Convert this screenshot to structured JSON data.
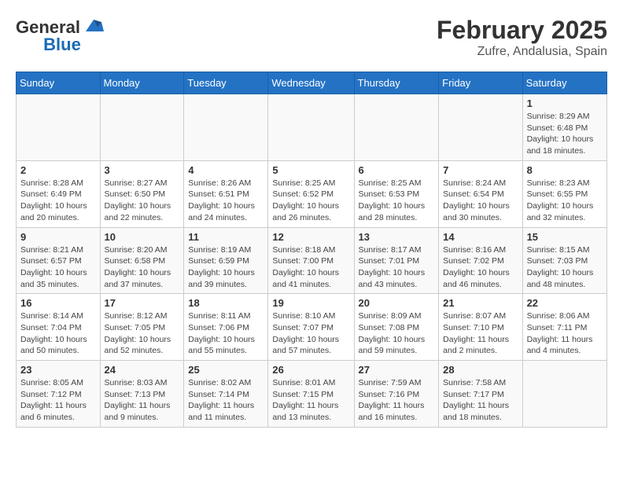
{
  "header": {
    "logo_general": "General",
    "logo_blue": "Blue",
    "title": "February 2025",
    "subtitle": "Zufre, Andalusia, Spain"
  },
  "calendar": {
    "days_of_week": [
      "Sunday",
      "Monday",
      "Tuesday",
      "Wednesday",
      "Thursday",
      "Friday",
      "Saturday"
    ],
    "weeks": [
      [
        {
          "day": "",
          "info": ""
        },
        {
          "day": "",
          "info": ""
        },
        {
          "day": "",
          "info": ""
        },
        {
          "day": "",
          "info": ""
        },
        {
          "day": "",
          "info": ""
        },
        {
          "day": "",
          "info": ""
        },
        {
          "day": "1",
          "info": "Sunrise: 8:29 AM\nSunset: 6:48 PM\nDaylight: 10 hours and 18 minutes."
        }
      ],
      [
        {
          "day": "2",
          "info": "Sunrise: 8:28 AM\nSunset: 6:49 PM\nDaylight: 10 hours and 20 minutes."
        },
        {
          "day": "3",
          "info": "Sunrise: 8:27 AM\nSunset: 6:50 PM\nDaylight: 10 hours and 22 minutes."
        },
        {
          "day": "4",
          "info": "Sunrise: 8:26 AM\nSunset: 6:51 PM\nDaylight: 10 hours and 24 minutes."
        },
        {
          "day": "5",
          "info": "Sunrise: 8:25 AM\nSunset: 6:52 PM\nDaylight: 10 hours and 26 minutes."
        },
        {
          "day": "6",
          "info": "Sunrise: 8:25 AM\nSunset: 6:53 PM\nDaylight: 10 hours and 28 minutes."
        },
        {
          "day": "7",
          "info": "Sunrise: 8:24 AM\nSunset: 6:54 PM\nDaylight: 10 hours and 30 minutes."
        },
        {
          "day": "8",
          "info": "Sunrise: 8:23 AM\nSunset: 6:55 PM\nDaylight: 10 hours and 32 minutes."
        }
      ],
      [
        {
          "day": "9",
          "info": "Sunrise: 8:21 AM\nSunset: 6:57 PM\nDaylight: 10 hours and 35 minutes."
        },
        {
          "day": "10",
          "info": "Sunrise: 8:20 AM\nSunset: 6:58 PM\nDaylight: 10 hours and 37 minutes."
        },
        {
          "day": "11",
          "info": "Sunrise: 8:19 AM\nSunset: 6:59 PM\nDaylight: 10 hours and 39 minutes."
        },
        {
          "day": "12",
          "info": "Sunrise: 8:18 AM\nSunset: 7:00 PM\nDaylight: 10 hours and 41 minutes."
        },
        {
          "day": "13",
          "info": "Sunrise: 8:17 AM\nSunset: 7:01 PM\nDaylight: 10 hours and 43 minutes."
        },
        {
          "day": "14",
          "info": "Sunrise: 8:16 AM\nSunset: 7:02 PM\nDaylight: 10 hours and 46 minutes."
        },
        {
          "day": "15",
          "info": "Sunrise: 8:15 AM\nSunset: 7:03 PM\nDaylight: 10 hours and 48 minutes."
        }
      ],
      [
        {
          "day": "16",
          "info": "Sunrise: 8:14 AM\nSunset: 7:04 PM\nDaylight: 10 hours and 50 minutes."
        },
        {
          "day": "17",
          "info": "Sunrise: 8:12 AM\nSunset: 7:05 PM\nDaylight: 10 hours and 52 minutes."
        },
        {
          "day": "18",
          "info": "Sunrise: 8:11 AM\nSunset: 7:06 PM\nDaylight: 10 hours and 55 minutes."
        },
        {
          "day": "19",
          "info": "Sunrise: 8:10 AM\nSunset: 7:07 PM\nDaylight: 10 hours and 57 minutes."
        },
        {
          "day": "20",
          "info": "Sunrise: 8:09 AM\nSunset: 7:08 PM\nDaylight: 10 hours and 59 minutes."
        },
        {
          "day": "21",
          "info": "Sunrise: 8:07 AM\nSunset: 7:10 PM\nDaylight: 11 hours and 2 minutes."
        },
        {
          "day": "22",
          "info": "Sunrise: 8:06 AM\nSunset: 7:11 PM\nDaylight: 11 hours and 4 minutes."
        }
      ],
      [
        {
          "day": "23",
          "info": "Sunrise: 8:05 AM\nSunset: 7:12 PM\nDaylight: 11 hours and 6 minutes."
        },
        {
          "day": "24",
          "info": "Sunrise: 8:03 AM\nSunset: 7:13 PM\nDaylight: 11 hours and 9 minutes."
        },
        {
          "day": "25",
          "info": "Sunrise: 8:02 AM\nSunset: 7:14 PM\nDaylight: 11 hours and 11 minutes."
        },
        {
          "day": "26",
          "info": "Sunrise: 8:01 AM\nSunset: 7:15 PM\nDaylight: 11 hours and 13 minutes."
        },
        {
          "day": "27",
          "info": "Sunrise: 7:59 AM\nSunset: 7:16 PM\nDaylight: 11 hours and 16 minutes."
        },
        {
          "day": "28",
          "info": "Sunrise: 7:58 AM\nSunset: 7:17 PM\nDaylight: 11 hours and 18 minutes."
        },
        {
          "day": "",
          "info": ""
        }
      ]
    ]
  }
}
